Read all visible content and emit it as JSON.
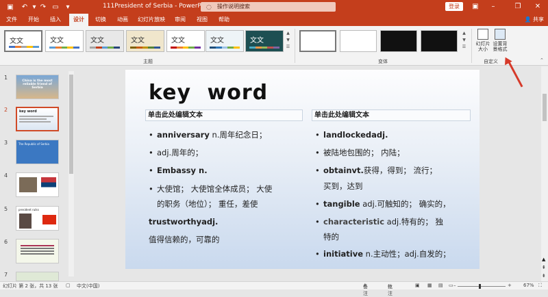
{
  "titlebar": {
    "doc_title": "111President of Serbia  -  PowerPoint",
    "tell_me": "操作说明搜索",
    "login": "登录",
    "share": "共享"
  },
  "tabs": [
    "文件",
    "开始",
    "插入",
    "设计",
    "切换",
    "动画",
    "幻灯片放映",
    "审阅",
    "视图",
    "帮助"
  ],
  "active_tab": "设计",
  "ribbon": {
    "theme_text": "文文",
    "group_themes": "主题",
    "group_variants": "变体",
    "group_customize": "自定义",
    "slide_size_label": "幻灯片大小",
    "format_bg_label": "设置背景格式"
  },
  "thumbnails": [
    {
      "num": "1",
      "text": "China is the most reliable friend of Serbia"
    },
    {
      "num": "2",
      "text": "key word"
    },
    {
      "num": "3",
      "text": "The Republic of Serbia"
    },
    {
      "num": "4",
      "text": ""
    },
    {
      "num": "5",
      "text": "president ruiks"
    },
    {
      "num": "6",
      "text": ""
    },
    {
      "num": "7",
      "text": ""
    }
  ],
  "slide": {
    "title": "key word",
    "left_header": "单击此处编辑文本",
    "right_header": "单击此处编辑文本",
    "left_items": [
      {
        "bullet": "•",
        "bold": "anniversary",
        "rest": "  n.周年纪念日；"
      },
      {
        "bullet": "•",
        "bold": "",
        "rest": "adj.周年的；"
      },
      {
        "bullet": "•",
        "bold": "Embassy n.",
        "rest": ""
      },
      {
        "bullet": "•",
        "bold": "",
        "rest": "大使馆；  大使馆全体成员；  大使"
      },
      {
        "bullet": "",
        "bold": "",
        "rest": "的职务（地位）；  重任，差使"
      },
      {
        "bullet": "",
        "bold": "trustworthyadj.",
        "rest": ""
      },
      {
        "bullet": "",
        "bold": "",
        "rest": "值得信赖的，可靠的"
      }
    ],
    "right_items": [
      {
        "bullet": "•",
        "bold": "landlockedadj.",
        "rest": ""
      },
      {
        "bullet": "•",
        "bold": "",
        "rest": "被陆地包围的；  内陆；"
      },
      {
        "bullet": "•",
        "bold": "obtainvt.",
        "rest": "获得，得到；  流行；"
      },
      {
        "bullet": "",
        "bold": "",
        "rest": "买到，达到"
      },
      {
        "bullet": "•",
        "bold": "tangible",
        "rest": " adj.可触知的；  确实的，"
      },
      {
        "bullet": "•",
        "bold": "characteristic",
        "rest": "  adj.特有的；  独"
      },
      {
        "bullet": "",
        "bold": "",
        "rest": "特的"
      },
      {
        "bullet": "•",
        "bold": "initiative",
        "rest": "  n.主动性；adj.自发的；"
      }
    ]
  },
  "status": {
    "slide_info": "幻灯片 第 2 张，共 13 张",
    "language": "中文(中国)",
    "notes": "备注",
    "comments": "批注",
    "zoom": "67%"
  }
}
